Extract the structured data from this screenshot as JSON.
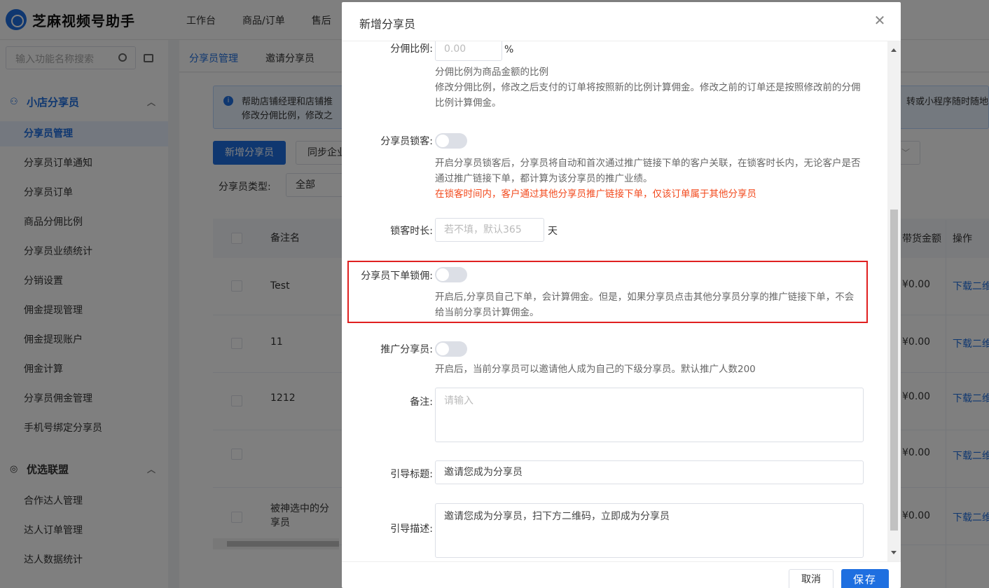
{
  "app": {
    "title": "芝麻视频号助手"
  },
  "topnav": [
    "工作台",
    "商品/订单",
    "售后"
  ],
  "sidebar": {
    "search_placeholder": "输入功能名称搜索",
    "groups": [
      {
        "label": "小店分享员",
        "icon": "share-people-icon"
      },
      {
        "label": "优选联盟",
        "icon": "alliance-icon"
      }
    ],
    "items": [
      "分享员管理",
      "分享员订单通知",
      "分享员订单",
      "商品分佣比例",
      "分享员业绩统计",
      "分销设置",
      "佣金提现管理",
      "佣金提现账户",
      "佣金计算",
      "分享员佣金管理",
      "手机号绑定分享员",
      "合作达人管理",
      "达人订单管理",
      "达人数据统计"
    ]
  },
  "subtabs": [
    "分享员管理",
    "邀请分享员"
  ],
  "background": {
    "info_line1": "帮助店铺经理和店铺推",
    "info_line2": "修改分佣比例，修改之",
    "info_right": "转或小程序随时随地",
    "add_button": "新增分享员",
    "sync_button": "同步企业",
    "filter_label": "分享员类型:",
    "filter_value": "全部",
    "table_headers": {
      "name": "备注名",
      "amount": "带货金额",
      "ops": "操作"
    },
    "rows": [
      {
        "name": "Test",
        "amount": "¥0.00",
        "op": "下载二维"
      },
      {
        "name": "11",
        "amount": "¥0.00",
        "op": "下载二维"
      },
      {
        "name": "1212",
        "amount": "¥0.00",
        "op": "下载二维"
      },
      {
        "name": "",
        "amount": "¥0.00",
        "op": "下载二维"
      },
      {
        "name": "被神选中的分享员",
        "amount": "¥0.00",
        "op": "下载二维"
      }
    ]
  },
  "modal": {
    "title": "新增分享员",
    "close_icon": "close-icon",
    "commission": {
      "label": "分佣比例:",
      "placeholder": "0.00",
      "unit": "%",
      "desc1": "分佣比例为商品金额的比例",
      "desc2": "修改分佣比例，修改之后支付的订单将按照新的比例计算佣金。修改之前的订单还是按照修改前的分佣比例计算佣金。"
    },
    "lock_customer": {
      "label": "分享员锁客:",
      "enabled": false,
      "desc": "开启分享员锁客后，分享员将自动和首次通过推广链接下单的客户关联，在锁客时长内，无论客户是否通过推广链接下单，都计算为该分享员的推广业绩。",
      "warning": "在锁客时间内，客户通过其他分享员推广链接下单，仅该订单属于其他分享员"
    },
    "lock_duration": {
      "label": "锁客时长:",
      "placeholder": "若不填，默认365",
      "unit": "天"
    },
    "self_order_lock": {
      "label": "分享员下单锁佣:",
      "enabled": false,
      "desc": "开启后,分享员自己下单，会计算佣金。但是，如果分享员点击其他分享员分享的推广链接下单，不会给当前分享员计算佣金。"
    },
    "promote": {
      "label": "推广分享员:",
      "enabled": false,
      "desc": "开启后，当前分享员可以邀请他人成为自己的下级分享员。默认推广人数200"
    },
    "remark": {
      "label": "备注:",
      "placeholder": "请输入"
    },
    "guide_title": {
      "label": "引导标题:",
      "value": "邀请您成为分享员"
    },
    "guide_desc": {
      "label": "引导描述:",
      "value": "邀请您成为分享员，扫下方二维码，立即成为分享员"
    },
    "cancel_label": "取消",
    "save_label": "保存"
  },
  "colors": {
    "primary": "#1e6fe0",
    "warning": "#f2491c",
    "highlight": "#e02020"
  }
}
